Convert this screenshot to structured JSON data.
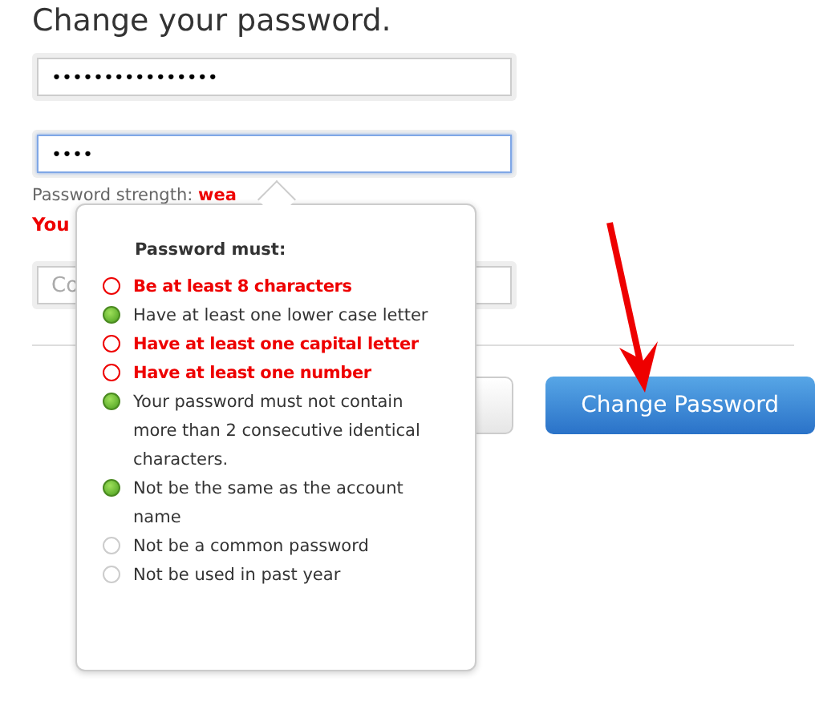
{
  "title": "Change your password.",
  "fields": [
    {
      "value": "••••••••••••••••",
      "focused": false
    },
    {
      "value": "••••",
      "focused": true
    }
  ],
  "strength": {
    "label": "Password strength:",
    "value": "wea"
  },
  "error": "You",
  "confirm_field": {
    "placeholder": "Co"
  },
  "popover": {
    "heading": "Password must:",
    "rules": [
      {
        "text": "Be at least 8 characters",
        "kind": "failed"
      },
      {
        "text": "Have at least one lower case letter",
        "kind": "passed"
      },
      {
        "text": "Have at least one capital letter",
        "kind": "failed"
      },
      {
        "text": "Have at least one number",
        "kind": "failed"
      },
      {
        "text": "Your password must not contain more than 2 consecutive identical characters.",
        "kind": "passed"
      },
      {
        "text": "Not be the same as the account name",
        "kind": "passed"
      },
      {
        "text": "Not be a common password",
        "kind": "pending"
      },
      {
        "text": "Not be used in past year",
        "kind": "pending"
      }
    ]
  },
  "submit_button": "Change Password"
}
